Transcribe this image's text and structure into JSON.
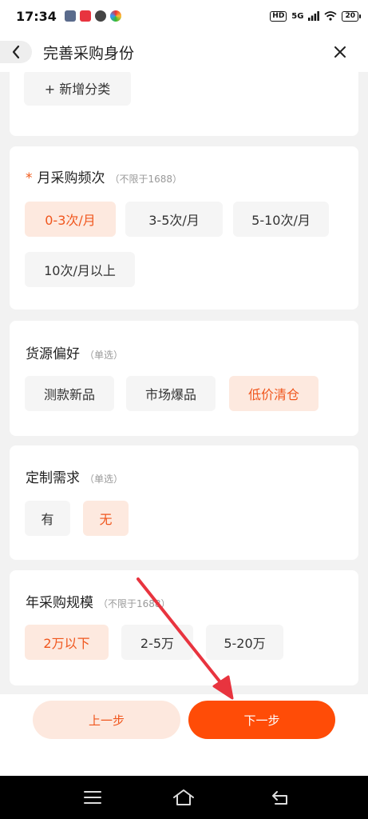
{
  "status_bar": {
    "time": "17:34",
    "hd": "HD",
    "network": "5G",
    "battery": "20"
  },
  "header": {
    "title": "完善采购身份"
  },
  "sections": {
    "category": {
      "add_label": "+ 新增分类"
    },
    "frequency": {
      "required_mark": "*",
      "title": "月采购频次",
      "note": "（不限于1688）",
      "options": [
        "0-3次/月",
        "3-5次/月",
        "5-10次/月",
        "10次/月以上"
      ],
      "selected": "0-3次/月"
    },
    "source": {
      "title": "货源偏好",
      "note": "（单选）",
      "options": [
        "测款新品",
        "市场爆品",
        "低价清仓"
      ],
      "selected": "低价清仓"
    },
    "custom": {
      "title": "定制需求",
      "note": "（单选）",
      "options": [
        "有",
        "无"
      ],
      "selected": "无"
    },
    "scale": {
      "title": "年采购规模",
      "note": "（不限于1688）",
      "options": [
        "2万以下",
        "2-5万",
        "5-20万"
      ],
      "selected": "2万以下"
    }
  },
  "footer": {
    "prev_label": "上一步",
    "next_label": "下一步"
  },
  "colors": {
    "accent": "#ff4c07",
    "selected_bg": "#fde9df",
    "selected_text": "#f0561d",
    "annotation_arrow": "#e8343f"
  },
  "icons": {
    "back": "chevron-left-icon",
    "close": "close-icon",
    "nav_menu": "menu-icon",
    "nav_home": "home-icon",
    "nav_back": "back-icon"
  }
}
